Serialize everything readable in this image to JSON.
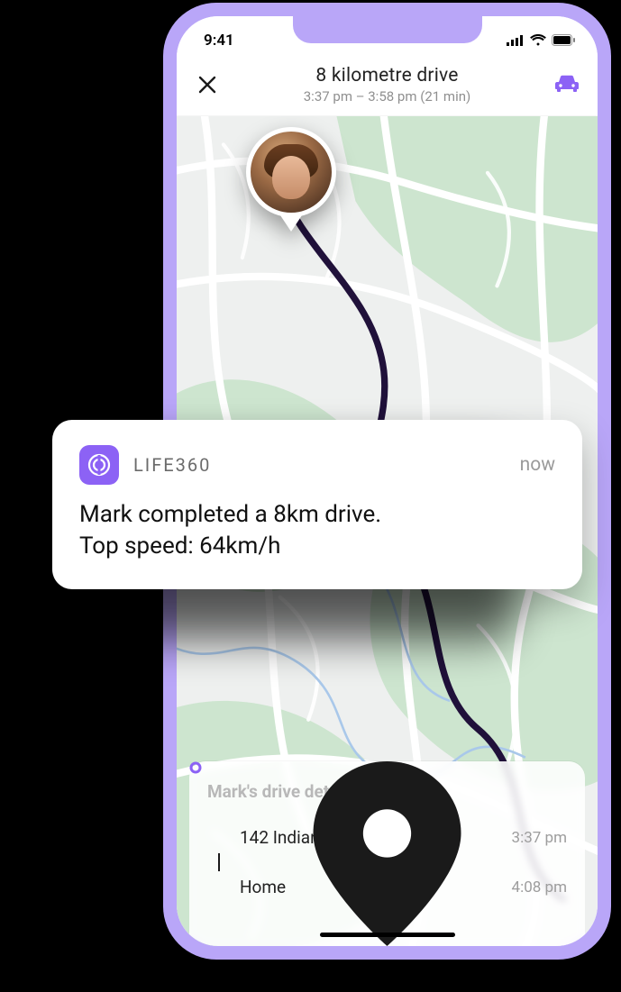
{
  "status": {
    "time": "9:41"
  },
  "header": {
    "title": "8 kilometre drive",
    "subtitle": "3:37 pm – 3:58 pm (21 min)"
  },
  "sheet": {
    "title": "Mark's drive details",
    "stops": [
      {
        "label": "142 Indian Park Dr",
        "time": "3:37 pm"
      },
      {
        "label": "Home",
        "time": "4:08 pm"
      }
    ]
  },
  "notification": {
    "app": "LIFE360",
    "when": "now",
    "line1": "Mark completed a 8km drive.",
    "line2": "Top speed: 64km/h"
  }
}
